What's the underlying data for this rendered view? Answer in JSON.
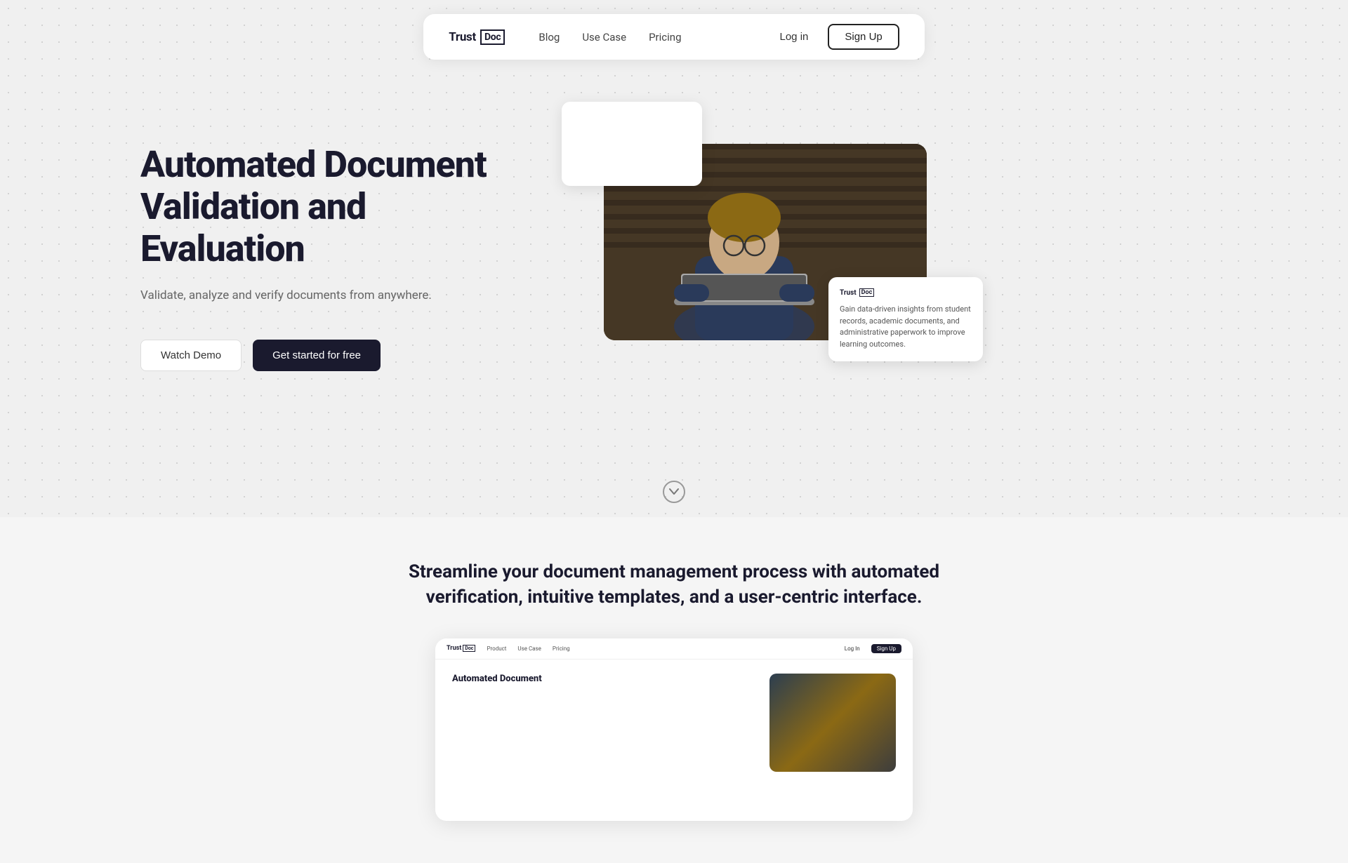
{
  "navbar": {
    "logo_text": "Trust",
    "logo_box": "Doc",
    "links": [
      {
        "label": "Blog",
        "id": "blog"
      },
      {
        "label": "Use Case",
        "id": "use-case"
      },
      {
        "label": "Pricing",
        "id": "pricing"
      }
    ],
    "login_label": "Log in",
    "signup_label": "Sign Up"
  },
  "hero": {
    "title_line1": "Automated Document",
    "title_line2": "Validation and Evaluation",
    "subtitle": "Validate, analyze and verify documents from anywhere.",
    "watch_demo_label": "Watch Demo",
    "get_started_label": "Get started for free",
    "floating_card_text": "Gain data-driven insights from student records, academic documents, and administrative paperwork to improve learning outcomes.",
    "card_logo_text": "Trust",
    "card_logo_box": "Doc"
  },
  "scroll_indicator": {
    "icon": "chevron-down"
  },
  "section2": {
    "title": "Streamline your document management process with automated verification, intuitive templates, and a user-centric interface.",
    "preview": {
      "navbar_logo": "Trust",
      "navbar_logo_box": "Doc",
      "nav_links": [
        "Product",
        "Use Case",
        "Pricing"
      ],
      "login_label": "Log In",
      "signup_label": "Sign Up",
      "hero_title": "Automated Document"
    }
  }
}
